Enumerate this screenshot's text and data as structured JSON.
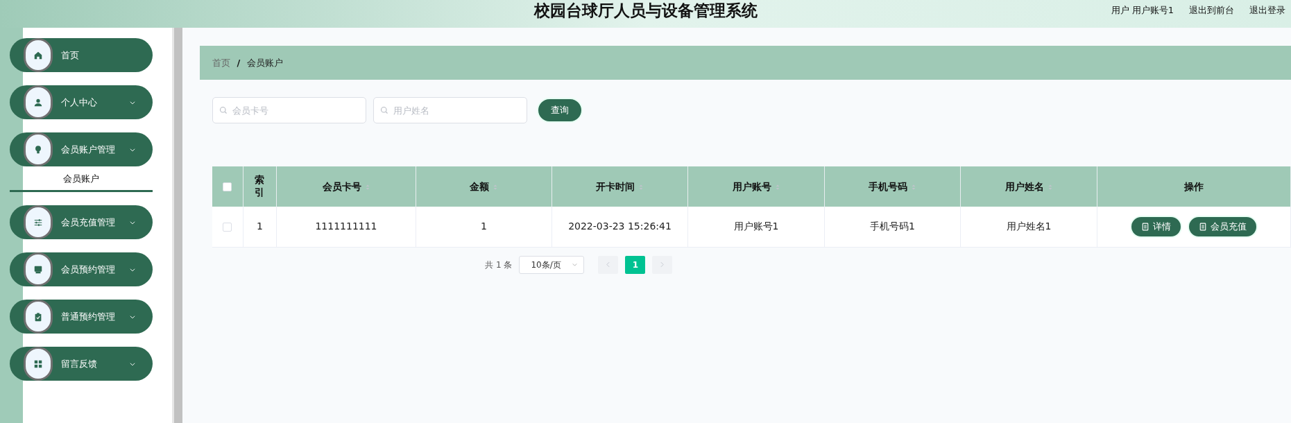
{
  "header": {
    "title": "校园台球厅人员与设备管理系统",
    "user": "用户 用户账号1",
    "links": [
      "退出到前台",
      "退出登录"
    ]
  },
  "sidebar": {
    "items": [
      {
        "label": "首页",
        "kind": "link"
      },
      {
        "label": "个人中心",
        "kind": "group"
      },
      {
        "label": "会员账户管理",
        "kind": "group",
        "children": [
          {
            "label": "会员账户",
            "selected": true
          }
        ]
      },
      {
        "label": "会员充值管理",
        "kind": "group"
      },
      {
        "label": "会员预约管理",
        "kind": "group"
      },
      {
        "label": "普通预约管理",
        "kind": "group"
      },
      {
        "label": "留言反馈",
        "kind": "group"
      }
    ]
  },
  "breadcrumb": [
    "首页",
    "/",
    "会员账户"
  ],
  "search": {
    "fields": [
      {
        "placeholder": "会员卡号"
      },
      {
        "placeholder": "用户姓名"
      }
    ],
    "button": "查询"
  },
  "table": {
    "header_checked": false,
    "columns": [
      {
        "label": "索引",
        "sortable": false
      },
      {
        "label": "会员卡号",
        "sortable": true
      },
      {
        "label": "金额",
        "sortable": true
      },
      {
        "label": "开卡时间",
        "sortable": true
      },
      {
        "label": "用户账号",
        "sortable": true
      },
      {
        "label": "手机号码",
        "sortable": true
      },
      {
        "label": "用户姓名",
        "sortable": true
      },
      {
        "label": "操作",
        "sortable": false
      }
    ],
    "rows": [
      {
        "checked": false,
        "cells": [
          "1",
          "1111111111",
          "1",
          "2022-03-23 15:26:41",
          "用户账号1",
          "手机号码1",
          "用户姓名1"
        ],
        "actions": [
          "详情",
          "会员充值"
        ]
      }
    ]
  },
  "pagination": {
    "total": "共 1 条",
    "page_size": "10条/页",
    "prev_disabled": true,
    "next_disabled": true,
    "pages": [
      {
        "label": "1",
        "selected": true
      }
    ]
  }
}
